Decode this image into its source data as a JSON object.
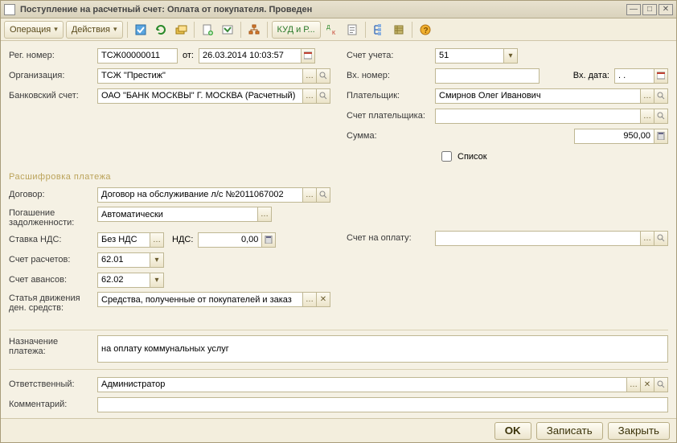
{
  "window": {
    "title": "Поступление на расчетный счет: Оплата от покупателя. Проведен"
  },
  "toolbar": {
    "operation": "Операция",
    "actions": "Действия",
    "kud": "КУД и Р..."
  },
  "labels": {
    "reg_number": "Рег. номер:",
    "from": "от:",
    "organization": "Организация:",
    "bank_account": "Банковский счет:",
    "account": "Счет учета:",
    "in_number": "Вх. номер:",
    "in_date": "Вх. дата:",
    "payer": "Плательщик:",
    "payer_account": "Счет плательщика:",
    "amount": "Сумма:",
    "list": "Список",
    "section_payment": "Расшифровка платежа",
    "contract": "Договор:",
    "debt_repay_label1": "Погашение",
    "debt_repay_label2": "задолженности:",
    "vat_rate": "Ставка НДС:",
    "vat": "НДС:",
    "invoice": "Счет на оплату:",
    "settlement_account": "Счет расчетов:",
    "advance_account": "Счет авансов:",
    "cashflow_label1": "Статья движения",
    "cashflow_label2": "ден. средств:",
    "purpose_label1": "Назначение",
    "purpose_label2": "платежа:",
    "responsible": "Ответственный:",
    "comment": "Комментарий:"
  },
  "values": {
    "reg_number": "ТСЖ00000011",
    "date": "26.03.2014 10:03:57",
    "organization": "ТСЖ \"Престиж\"",
    "bank_account": "ОАО \"БАНК МОСКВЫ\" Г. МОСКВА (Расчетный)",
    "account": "51",
    "in_number": "",
    "in_date": ". .",
    "payer": "Смирнов Олег Иванович",
    "payer_account": "",
    "amount": "950,00",
    "contract": "Договор на обслуживание л/с №2011067002",
    "debt_repay": "Автоматически",
    "vat_rate": "Без НДС",
    "vat": "0,00",
    "invoice": "",
    "settlement_account": "62.01",
    "advance_account": "62.02",
    "cashflow": "Средства, полученные от покупателей и заказ",
    "purpose": "на оплату коммунальных услуг",
    "responsible": "Администратор",
    "comment": ""
  },
  "footer": {
    "ok": "OK",
    "save": "Записать",
    "close": "Закрыть"
  }
}
